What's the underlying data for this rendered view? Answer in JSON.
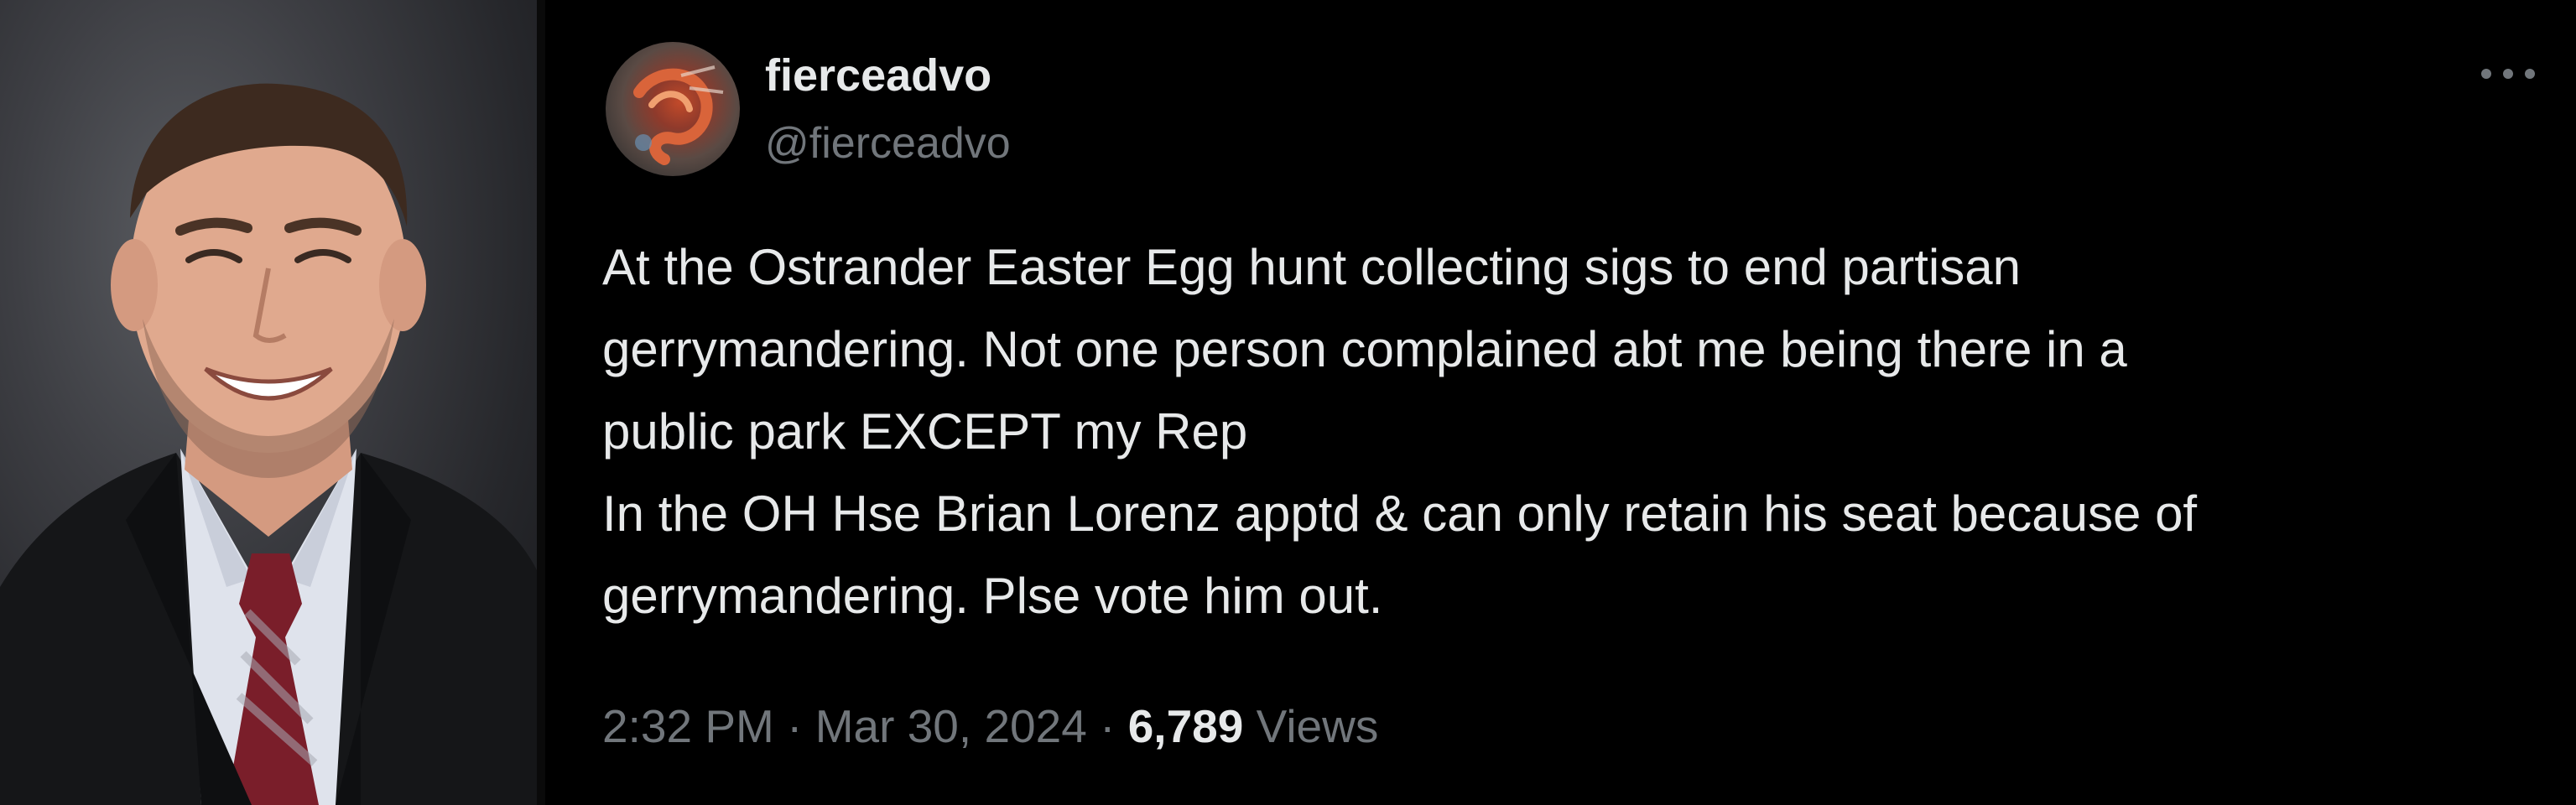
{
  "tweet": {
    "display_name": "fierceadvo",
    "handle": "@fierceadvo",
    "more_icon": "more-horizontal-icon",
    "text_lines": [
      "At the Ostrander Easter Egg hunt collecting sigs to end partisan",
      "gerrymandering. Not one person complained abt me being there in a",
      "public park EXCEPT my Rep",
      "In the OH Hse Brian Lorenz apptd & can only retain his seat because of",
      "gerrymandering. Plse vote him out."
    ],
    "time": "2:32 PM",
    "separator": "·",
    "date": "Mar 30, 2024",
    "views_count": "6,789",
    "views_label": "Views"
  },
  "colors": {
    "background": "#000000",
    "primary_text": "#e7e9ea",
    "secondary_text": "#71767b"
  }
}
